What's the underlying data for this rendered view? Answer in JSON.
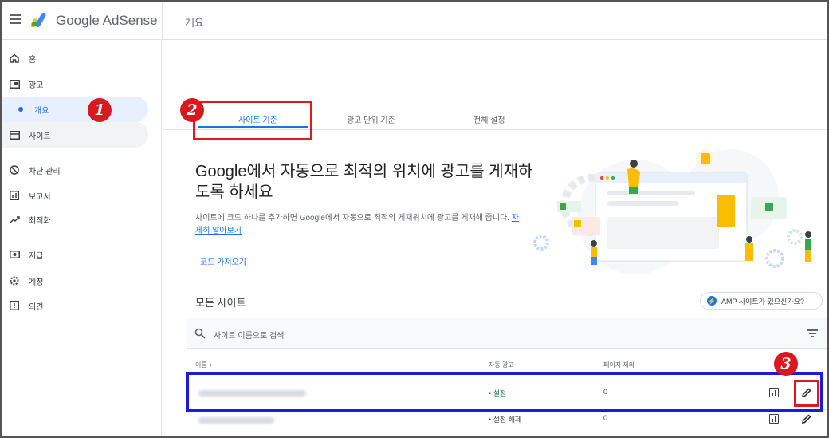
{
  "header": {
    "brand": "Google AdSense",
    "page_title": "개요"
  },
  "sidebar": {
    "items": [
      {
        "icon": "home-icon",
        "label": "홈"
      },
      {
        "icon": "ads-icon",
        "label": "광고"
      },
      {
        "icon": "dot",
        "label": "개요"
      },
      {
        "icon": "sites-icon",
        "label": "사이트"
      },
      {
        "icon": "block-icon",
        "label": "차단 관리"
      },
      {
        "icon": "reports-icon",
        "label": "보고서"
      },
      {
        "icon": "optimize-icon",
        "label": "최적화"
      },
      {
        "icon": "payments-icon",
        "label": "지급"
      },
      {
        "icon": "account-icon",
        "label": "계정"
      },
      {
        "icon": "feedback-icon",
        "label": "의견"
      }
    ]
  },
  "tabs": [
    {
      "label": "사이트 기준",
      "selected": true
    },
    {
      "label": "광고 단위 기준",
      "selected": false
    },
    {
      "label": "전체 설정",
      "selected": false
    }
  ],
  "hero": {
    "title": "Google에서 자동으로 최적의 위치에 광고를 게재하도록 하세요",
    "description": "사이트에 코드 하나를 추가하면 Google에서 자동으로 최적의 게재위치에 광고를 게재해 줍니다.",
    "learn_more": "자세히 알아보기",
    "get_code": "코드 가져오기"
  },
  "sites": {
    "heading": "모든 사이트",
    "amp_button": "AMP 사이트가 있으신가요?",
    "search_placeholder": "사이트 이름으로 검색",
    "columns": {
      "name": "이름 ↑",
      "auto_ads": "자동 광고",
      "excluded_pages": "페이지 제외"
    },
    "rows": [
      {
        "name": "",
        "auto_ads": "• 설정",
        "excluded_pages": "0"
      },
      {
        "name": "",
        "auto_ads": "• 설정 해제",
        "excluded_pages": "0"
      }
    ]
  },
  "annotations": [
    "1",
    "2",
    "3"
  ],
  "colors": {
    "accent": "#1a73e8",
    "status_on": "#188038",
    "annotation_red": "#e0191f",
    "annotation_blue": "#1b1bdb"
  }
}
